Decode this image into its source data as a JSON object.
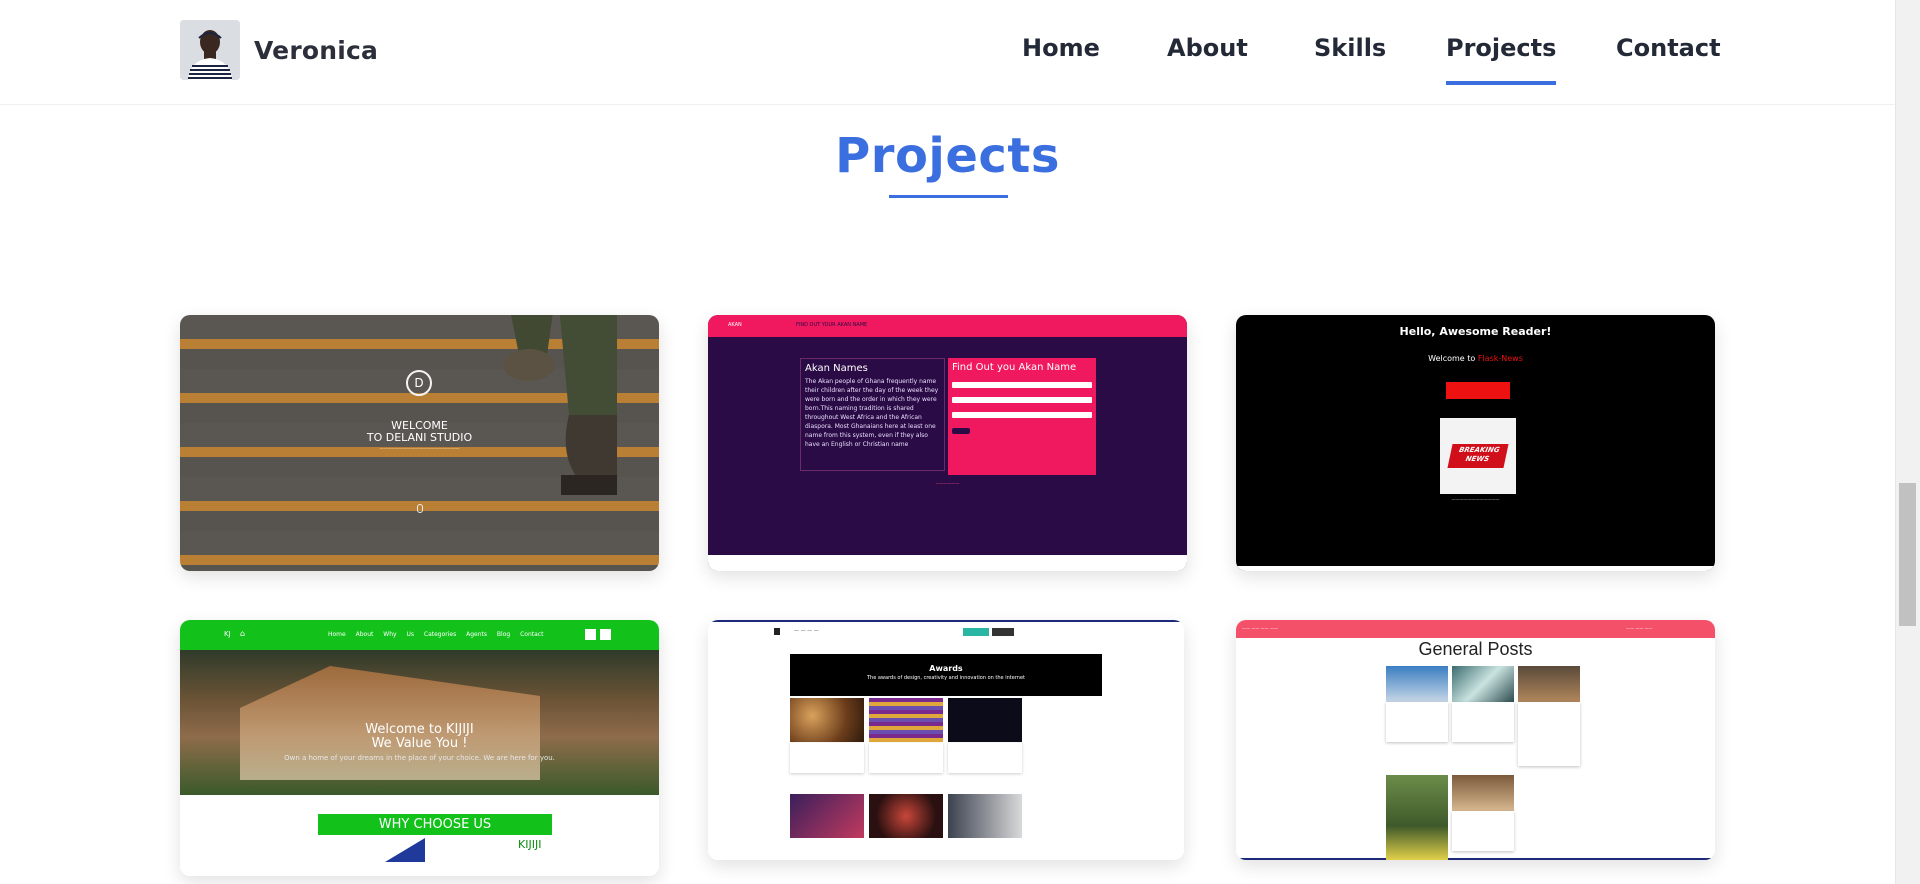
{
  "header": {
    "brand_name": "Veronica",
    "nav": [
      {
        "label": "Home"
      },
      {
        "label": "About"
      },
      {
        "label": "Skills"
      },
      {
        "label": "Projects",
        "active": true
      },
      {
        "label": "Contact"
      }
    ]
  },
  "projects": {
    "title": "Projects",
    "accent_color": "#3b6fe0",
    "cards": [
      {
        "name": "delani",
        "welcome_line1": "WELCOME",
        "welcome_line2": "TO DELANI STUDIO",
        "logo_letter": "D"
      },
      {
        "name": "akan",
        "nav_brand": "AKAN",
        "nav_title": "FIND OUT YOUR AKAN NAME",
        "info_title": "Akan Names",
        "info_text": "The Akan people of Ghana frequently name their children after the day of the week they were born and the order in which they were born.This naming tradition is shared throughout West Africa and the African diaspora. Most Ghanaians here at least one name from this system, even if they also have an English or Christian name",
        "form_title": "Find Out you Akan Name"
      },
      {
        "name": "flask-news",
        "greeting": "Hello, Awesome Reader!",
        "welcome_prefix": "Welcome to",
        "welcome_brand": "Flask-News",
        "badge_line1": "BREAKING",
        "badge_line2": "NEWS"
      },
      {
        "name": "kijiji",
        "logo": "KJ",
        "nav_links": "Home About Why Us Categories Agents Blog Contact",
        "hero_line1": "Welcome to KIJIJI",
        "hero_line2": "We Value You !",
        "hero_sub": "Own a home of your dreams in the place of your choice. We are here for you.",
        "why_label": "WHY CHOOSE US",
        "brand": "KIJIJI"
      },
      {
        "name": "awards",
        "banner_title": "Awards",
        "banner_sub": "The awards of design, creativity and innovation on the internet"
      },
      {
        "name": "general-posts",
        "heading": "General Posts"
      }
    ]
  }
}
